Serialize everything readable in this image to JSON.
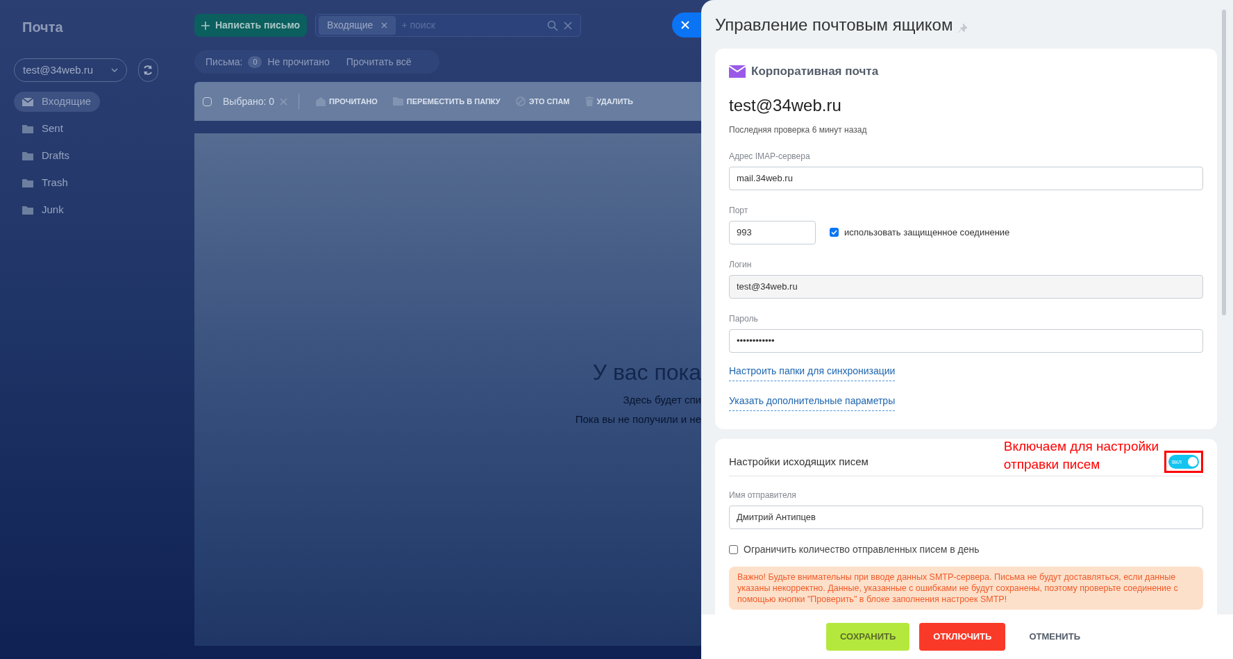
{
  "sidebar": {
    "title": "Почта",
    "account": "test@34web.ru",
    "folders": [
      {
        "label": "Входящие",
        "kind": "inbox",
        "selected": true
      },
      {
        "label": "Sent",
        "kind": "folder",
        "selected": false
      },
      {
        "label": "Drafts",
        "kind": "folder",
        "selected": false
      },
      {
        "label": "Trash",
        "kind": "folder",
        "selected": false
      },
      {
        "label": "Junk",
        "kind": "folder",
        "selected": false
      }
    ]
  },
  "topbar": {
    "compose": "Написать письмо",
    "search_tag": "Входящие",
    "search_placeholder": "+ поиск"
  },
  "filter": {
    "label": "Письма:",
    "count": "0",
    "unread": "Не прочитано",
    "read_all": "Прочитать всё"
  },
  "actions": {
    "select_all_checked": false,
    "selected": "Выбрано: 0",
    "buttons": [
      {
        "label": "ПРОЧИТАНО",
        "kind": "read"
      },
      {
        "label": "ПЕРЕМЕСТИТЬ В ПАПКУ",
        "kind": "move"
      },
      {
        "label": "ЭТО СПАМ",
        "kind": "spam"
      },
      {
        "label": "УДАЛИТЬ",
        "kind": "delete"
      }
    ]
  },
  "empty_state": {
    "title": "У вас пока",
    "lines": [
      "Здесь будет спи",
      "Пока вы не получили и не"
    ]
  },
  "panel": {
    "title": "Управление почтовым ящиком",
    "mailbox": {
      "heading": "Корпоративная почта",
      "email": "test@34web.ru",
      "last_check": "Последняя проверка 6 минут назад",
      "fields": [
        {
          "label": "Адрес IMAP-сервера",
          "value": "mail.34web.ru",
          "kind": "text"
        },
        {
          "label": "Порт",
          "value": "993",
          "kind": "port",
          "option": {
            "label": "использовать защищенное соединение",
            "checked": true
          }
        },
        {
          "label": "Логин",
          "value": "test@34web.ru",
          "kind": "readonly"
        },
        {
          "label": "Пароль",
          "value": "••••••••••••",
          "kind": "password"
        }
      ],
      "links": [
        "Настроить папки для синхронизации",
        "Указать дополнительные параметры"
      ]
    },
    "outgoing": {
      "heading": "Настройки исходящих писем",
      "toggle": {
        "label": "вкл",
        "on": true
      },
      "annotation": [
        "Включаем для настройки",
        "отправки писем"
      ],
      "sender_label": "Имя отправителя",
      "sender_value": "Дмитрий Антипцев",
      "limit": {
        "label": "Ограничить количество отправленных писем в день",
        "checked": false
      },
      "warning": "Важно! Будьте внимательны при вводе данных SMTP-сервера. Письма не будут доставляться, если данные указаны некорректно. Данные, указанные с ошибками не будут сохранены, поэтому проверьте соединение с помощью кнопки \"Проверить\" в блоке заполнения настроек SMTP!"
    },
    "buttons": [
      {
        "label": "СОХРАНИТЬ",
        "kind": "save"
      },
      {
        "label": "ОТКЛЮЧИТЬ",
        "kind": "disable"
      },
      {
        "label": "ОТМЕНИТЬ",
        "kind": "cancel"
      }
    ]
  }
}
